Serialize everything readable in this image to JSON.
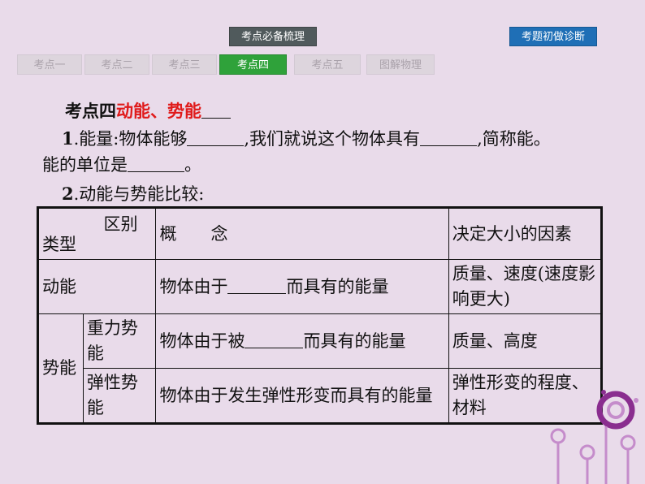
{
  "header": {
    "summary_label": "考点必备梳理",
    "diagnose_label": "考题初做诊断"
  },
  "tabs": [
    {
      "label": "考点一",
      "active": false
    },
    {
      "label": "考点二",
      "active": false
    },
    {
      "label": "考点三",
      "active": false
    },
    {
      "label": "考点四",
      "active": true
    },
    {
      "label": "考点五",
      "active": false
    },
    {
      "label": "图解物理",
      "active": false
    }
  ],
  "section": {
    "prefix": "考点四",
    "title": "动能、势能",
    "item1_num": "1",
    "item1_a": ".能量:物体能够",
    "item1_b": ",我们就说这个物体具有",
    "item1_c": ",简称能。",
    "item1_d": "能的单位是",
    "item1_e": "。",
    "item2_num": "2",
    "item2_text": ".动能与势能比较:"
  },
  "table": {
    "header_diff": "区别",
    "header_type": "类型",
    "header_concept": "概　　念",
    "header_factors": "决定大小的因素",
    "row_kinetic_label": "动能",
    "row_kinetic_concept_a": "物体由于",
    "row_kinetic_concept_b": "而具有的能量",
    "row_kinetic_factors": "质量、速度(速度影响更大)",
    "potential_label": "势能",
    "gravity_label": "重力势能",
    "gravity_concept_a": "物体由于被",
    "gravity_concept_b": "而具有的能量",
    "gravity_factors": "质量、高度",
    "elastic_label": "弹性势能",
    "elastic_concept": "物体由于发生弹性形变而具有的能量",
    "elastic_factors": "弹性形变的程度、材料"
  },
  "colors": {
    "background": "#e9dbea",
    "accent_active_tab": "#2fa23a",
    "diagnose_button": "#1f6fb6",
    "title_red": "#e01b1b",
    "deco_purple": "#8a2d8f"
  }
}
